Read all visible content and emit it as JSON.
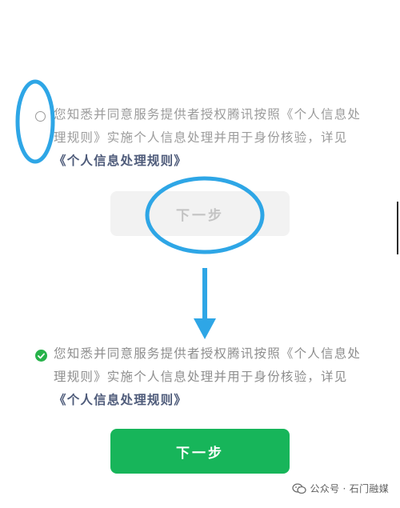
{
  "consent": {
    "text": "您知悉并同意服务提供者授权腾讯按照《个人信息处理规则》实施个人信息处理并用于身份核验，详见 ",
    "policy_link": "《个人信息处理规则》"
  },
  "next_button_label": "下一步",
  "states": {
    "before": {
      "checkbox_checked": false,
      "button_enabled": false
    },
    "after": {
      "checkbox_checked": true,
      "button_enabled": true
    }
  },
  "watermark": {
    "text": "公众号 · 石门融媒"
  },
  "colors": {
    "accent_green": "#17b55a",
    "check_green": "#27b24a",
    "annotation_blue": "#2ea6e6",
    "text_gray": "#9b9b9b",
    "link_color": "#4e5b7a",
    "disabled_button_bg": "#f2f2f2",
    "disabled_button_text": "#c3c3c3"
  },
  "icons": {
    "unchecked": "radio-unchecked-icon",
    "checked": "checkmark-circle-icon",
    "arrow": "arrow-down-icon",
    "watermark": "wechat-icon"
  }
}
